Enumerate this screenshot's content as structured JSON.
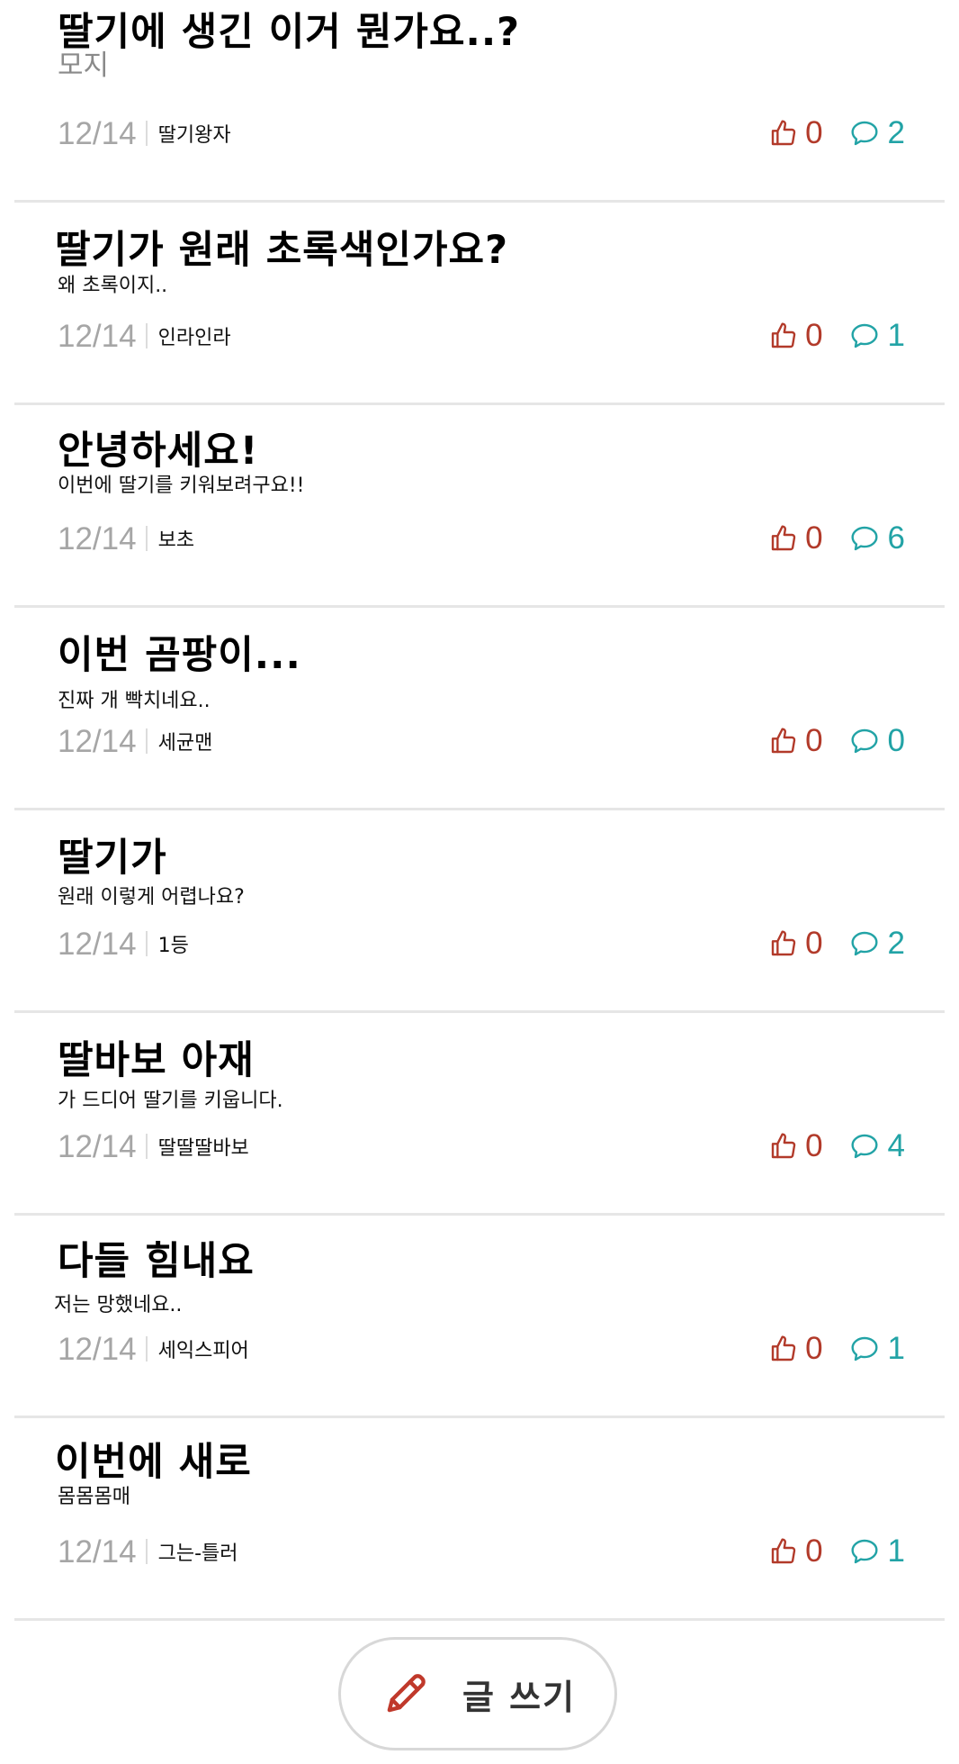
{
  "posts": [
    {
      "title": "딸기에 생긴 이거 뭔가요..?",
      "body": "모지",
      "date": "12/14",
      "author": "딸기왕자",
      "likes": "0",
      "comments": "2"
    },
    {
      "title": "딸기가 원래 초록색인가요?",
      "body": "왜 초록이지..",
      "date": "12/14",
      "author": "인라인라",
      "likes": "0",
      "comments": "1"
    },
    {
      "title": "안녕하세요!",
      "body": "이번에 딸기를 키워보려구요!!",
      "date": "12/14",
      "author": "보초",
      "likes": "0",
      "comments": "6"
    },
    {
      "title": "이번 곰팡이...",
      "body": "진짜 개 빡치네요..",
      "date": "12/14",
      "author": "세균맨",
      "likes": "0",
      "comments": "0"
    },
    {
      "title": "딸기가",
      "body": "원래 이렇게 어렵나요?",
      "date": "12/14",
      "author": "1등",
      "likes": "0",
      "comments": "2"
    },
    {
      "title": "딸바보 아재",
      "body": "가 드디어 딸기를 키웁니다.",
      "date": "12/14",
      "author": "딸딸딸바보",
      "likes": "0",
      "comments": "4"
    },
    {
      "title": "다들 힘내요",
      "body": "저는 망했네요..",
      "date": "12/14",
      "author": "세익스피어",
      "likes": "0",
      "comments": "1"
    },
    {
      "title": "이번에 새로",
      "body": "몸몸몸매",
      "date": "12/14",
      "author": "그는-틀러",
      "likes": "0",
      "comments": "1"
    }
  ],
  "write_button": {
    "label": "글 쓰기",
    "icon": "pencil-icon"
  },
  "icons": {
    "like": "thumbs-up-icon",
    "comment": "speech-bubble-icon"
  },
  "colors": {
    "like": "#b23a2a",
    "comment": "#22a3a6",
    "date": "#a6a6a6",
    "pencil": "#c0392b"
  }
}
